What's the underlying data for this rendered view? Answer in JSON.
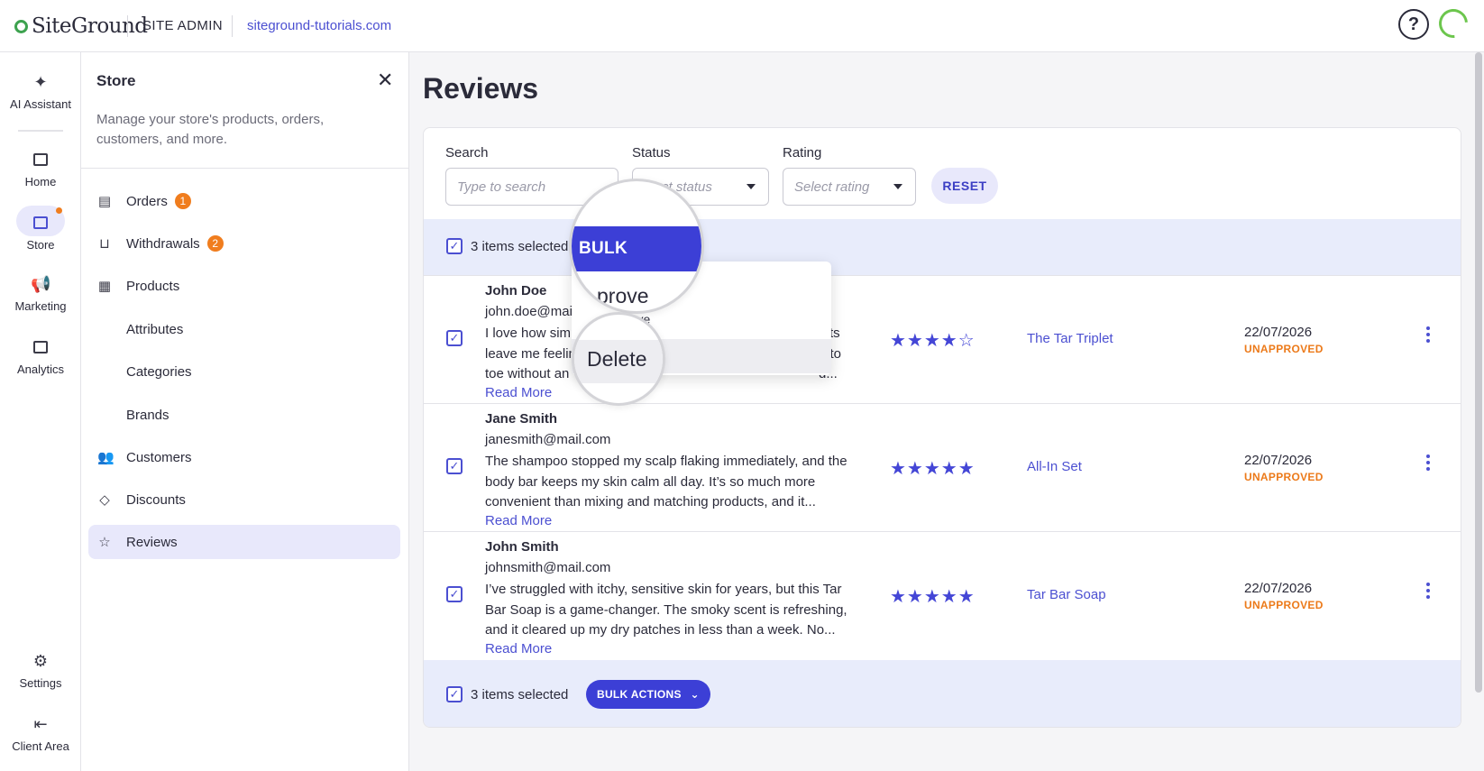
{
  "topbar": {
    "logo_text": "SiteGround",
    "section": "SITE ADMIN",
    "domain": "siteground-tutorials.com",
    "help_icon": "question-circle-icon"
  },
  "rail": {
    "items": [
      {
        "label": "AI Assistant",
        "icon": "sparkle-icon"
      },
      {
        "label": "Home",
        "icon": "home-icon"
      },
      {
        "label": "Store",
        "icon": "store-icon"
      },
      {
        "label": "Marketing",
        "icon": "megaphone-icon"
      },
      {
        "label": "Analytics",
        "icon": "chart-icon"
      },
      {
        "label": "Settings",
        "icon": "gear-icon"
      },
      {
        "label": "Client Area",
        "icon": "exit-icon"
      }
    ]
  },
  "panel": {
    "title": "Store",
    "description": "Manage your store's products, orders, customers, and more.",
    "nav": [
      {
        "label": "Orders",
        "badge": "1"
      },
      {
        "label": "Withdrawals",
        "badge": "2"
      },
      {
        "label": "Products"
      },
      {
        "label": "Attributes"
      },
      {
        "label": "Categories"
      },
      {
        "label": "Brands"
      },
      {
        "label": "Customers"
      },
      {
        "label": "Discounts"
      },
      {
        "label": "Reviews"
      }
    ]
  },
  "main": {
    "title": "Reviews",
    "filters": {
      "search_label": "Search",
      "search_placeholder": "Type to search",
      "status_label": "Status",
      "status_placeholder": "elect status",
      "rating_label": "Rating",
      "rating_placeholder": "Select rating",
      "reset_label": "RESET"
    },
    "bulk": {
      "selected_text": "3 items selected",
      "button_label": "BULK ACTIONS"
    },
    "bulk_menu": {
      "approve_zoom": "prove",
      "approve_small": "rove",
      "delete": "Delete"
    },
    "reviews": [
      {
        "name": "John Doe",
        "email": "john.doe@mail.c",
        "text_line1": "I love how simpl",
        "text_line1_end": "ts",
        "text_line2": "leave me feelin",
        "text_line2_end": "d to",
        "text_line3": "toe without an",
        "text_line3_end": "d...",
        "read_more": "Read More",
        "rating": 4,
        "stars": "★★★★",
        "empty_stars": "☆",
        "product": "The Tar Triplet",
        "date": "22/07/2026",
        "status": "UNAPPROVED"
      },
      {
        "name": "Jane Smith",
        "email": "janesmith@mail.com",
        "text": "The shampoo stopped my scalp flaking immediately, and the body bar keeps my skin calm all day. It’s so much more convenient than mixing and matching products, and it...",
        "read_more": "Read More",
        "rating": 5,
        "stars": "★★★★★",
        "product": "All-In Set",
        "date": "22/07/2026",
        "status": "UNAPPROVED"
      },
      {
        "name": "John Smith",
        "email": "johnsmith@mail.com",
        "text": "I’ve struggled with itchy, sensitive skin for years, but this Tar Bar Soap is a game-changer. The smoky scent is refreshing, and it cleared up my dry patches in less than a week. No...",
        "read_more": "Read More",
        "rating": 5,
        "stars": "★★★★★",
        "product": "Tar Bar Soap",
        "date": "22/07/2026",
        "status": "UNAPPROVED"
      }
    ]
  },
  "colors": {
    "accent": "#3c3fd6",
    "link": "#4b4fd1",
    "status_unapproved": "#ec7a1a",
    "badge": "#f07d1e",
    "active_bg": "#e8e8fb"
  }
}
